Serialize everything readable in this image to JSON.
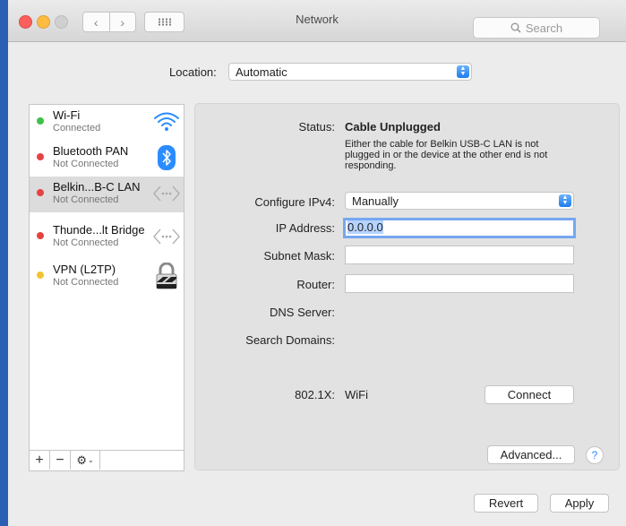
{
  "window": {
    "title": "Network",
    "search_placeholder": "Search"
  },
  "location": {
    "label": "Location:",
    "value": "Automatic"
  },
  "services": [
    {
      "name": "Wi-Fi",
      "status": "Connected",
      "dot_color": "#3ec04a",
      "icon": "wifi-icon"
    },
    {
      "name": "Bluetooth PAN",
      "status": "Not Connected",
      "dot_color": "#e64242",
      "icon": "bluetooth-icon"
    },
    {
      "name": "Belkin...B-C LAN",
      "status": "Not Connected",
      "dot_color": "#e64242",
      "icon": "ethernet-icon",
      "selected": true
    },
    {
      "name": "Thunde...lt Bridge",
      "status": "Not Connected",
      "dot_color": "#e64242",
      "icon": "ethernet-icon"
    },
    {
      "name": "VPN (L2TP)",
      "status": "Not Connected",
      "dot_color": "#f2c330",
      "icon": "lock-icon"
    }
  ],
  "sidebar_tools": {
    "add": "+",
    "remove": "−",
    "gear": "⚙",
    "gear_menu": "⌄"
  },
  "details": {
    "status_label": "Status:",
    "status_value": "Cable Unplugged",
    "status_desc_1": "Either the cable for Belkin USB-C LAN is not",
    "status_desc_2": "plugged in or the device at the other end is not",
    "status_desc_3": "responding.",
    "configure_label": "Configure IPv4:",
    "configure_value": "Manually",
    "ip_label": "IP Address:",
    "ip_value": "0.0.0.0",
    "subnet_label": "Subnet Mask:",
    "subnet_value": "",
    "router_label": "Router:",
    "router_value": "",
    "dns_label": "DNS Server:",
    "search_domains_label": "Search Domains:",
    "dot1x_label": "802.1X:",
    "dot1x_value": "WiFi",
    "connect_button": "Connect",
    "advanced_button": "Advanced...",
    "help_button": "?"
  },
  "footer": {
    "revert_button": "Revert",
    "apply_button": "Apply"
  },
  "colors": {
    "accent": "#1d7bf0",
    "desktop": "#2b5fb3"
  }
}
